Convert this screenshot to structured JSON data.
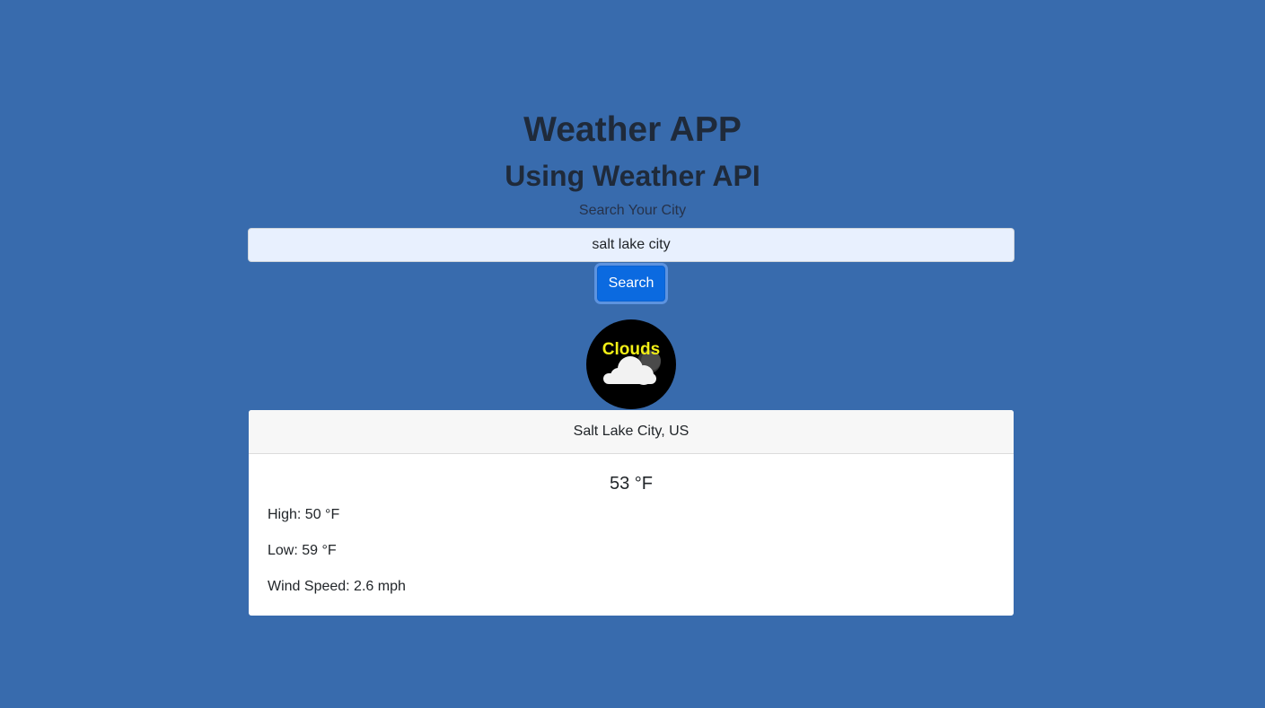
{
  "header": {
    "title": "Weather APP",
    "subtitle": "Using Weather API"
  },
  "search": {
    "label": "Search Your City",
    "value": "salt lake city",
    "button_label": "Search"
  },
  "weather": {
    "condition": "Clouds",
    "icon": "cloud-icon",
    "location": "Salt Lake City, US",
    "temperature": "53 °F",
    "high": "High: 50 °F",
    "low": "Low: 59 °F",
    "wind_speed": "Wind Speed: 2.6 mph"
  },
  "colors": {
    "background": "#386bad",
    "button": "#0b6ae0",
    "condition_text": "#f2ef16",
    "badge": "#000000"
  }
}
